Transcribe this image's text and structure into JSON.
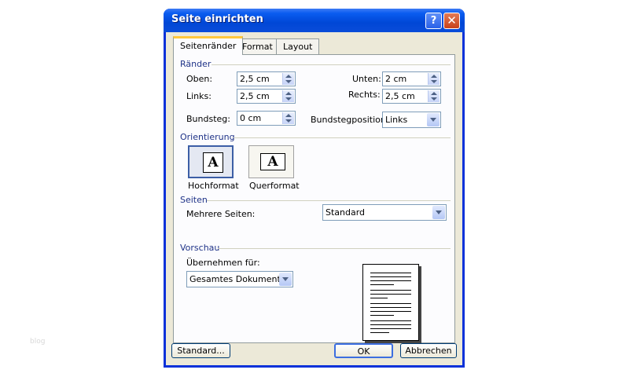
{
  "window": {
    "title": "Seite einrichten",
    "help_glyph": "?",
    "close_glyph": "✕"
  },
  "tabs": [
    {
      "label": "Seitenränder",
      "active": true
    },
    {
      "label": "Format",
      "active": false
    },
    {
      "label": "Layout",
      "active": false
    }
  ],
  "margins": {
    "group_label": "Ränder",
    "top": {
      "label": "Oben:",
      "value": "2,5 cm"
    },
    "bottom": {
      "label": "Unten:",
      "value": "2 cm"
    },
    "left": {
      "label": "Links:",
      "value": "2,5 cm"
    },
    "right": {
      "label": "Rechts:",
      "value": "2,5 cm"
    },
    "gutter": {
      "label": "Bundsteg:",
      "value": "0 cm"
    },
    "gutter_position": {
      "label": "Bundstegposition:",
      "value": "Links"
    }
  },
  "orientation": {
    "group_label": "Orientierung",
    "portrait": {
      "label": "Hochformat",
      "glyph": "A",
      "selected": true
    },
    "landscape": {
      "label": "Querformat",
      "glyph": "A",
      "selected": false
    }
  },
  "pages": {
    "group_label": "Seiten",
    "multiple_pages": {
      "label": "Mehrere Seiten:",
      "value": "Standard"
    }
  },
  "preview": {
    "group_label": "Vorschau",
    "apply_to": {
      "label": "Übernehmen für:",
      "value": "Gesamtes Dokument"
    }
  },
  "buttons": {
    "default": "Standard...",
    "ok": "OK",
    "cancel": "Abbrechen"
  },
  "watermark": "blog",
  "colors": {
    "titlebar": "#0a5cf0",
    "dialog_bg": "#ece9d8",
    "active_tab_accent": "#ffc83c",
    "group_label": "#1e3287"
  }
}
